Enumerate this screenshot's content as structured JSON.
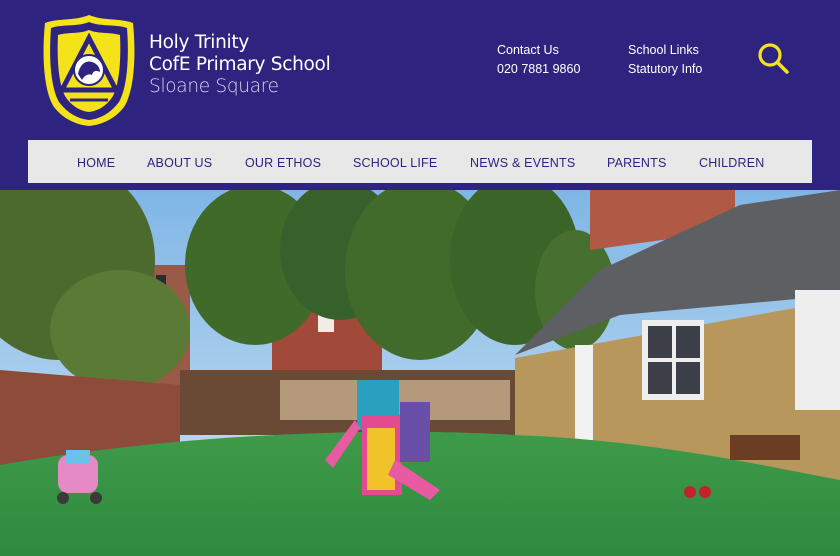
{
  "school": {
    "line1": "Holy Trinity",
    "line2": "CofE Primary School",
    "line3": "Sloane Square"
  },
  "header_links": {
    "contact_label": "Contact Us",
    "phone": "020 7881 9860",
    "school_links": "School Links",
    "statutory_info": "Statutory Info"
  },
  "nav": {
    "items": [
      "HOME",
      "ABOUT US",
      "OUR ETHOS",
      "SCHOOL LIFE",
      "NEWS & EVENTS",
      "PARENTS",
      "CHILDREN"
    ]
  },
  "colors": {
    "header_bg": "#2e2480",
    "accent_yellow": "#f4e21b",
    "nav_bg": "#e8e8e8",
    "nav_text": "#2e2480"
  },
  "icons": {
    "search": "search-icon",
    "crest": "school-crest-logo"
  }
}
